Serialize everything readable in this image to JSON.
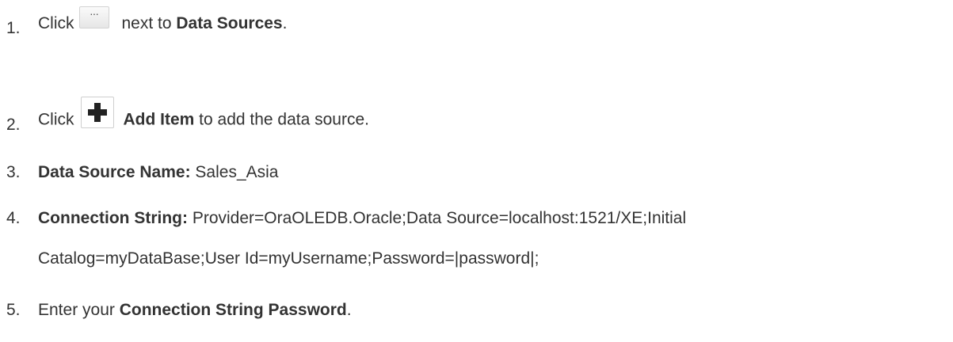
{
  "steps": [
    {
      "number": "1.",
      "text_before_icon": "Click",
      "icon": "ellipsis-icon",
      "text_after_icon": "next to ",
      "bold": "Data Sources",
      "text_end": "."
    },
    {
      "number": "2.",
      "text_before_icon": "Click",
      "icon": "plus-icon",
      "bold": "Add Item",
      "text_end": " to add the data source."
    },
    {
      "number": "3.",
      "bold": "Data Source Name:",
      "text_end": " Sales_Asia"
    },
    {
      "number": "4.",
      "bold": "Connection String:",
      "text_end": " Provider=OraOLEDB.Oracle;Data Source=localhost:1521/XE;Initial",
      "continuation": "Catalog=myDataBase;User Id=myUsername;Password=|password|;"
    },
    {
      "number": "5.",
      "text_before": "Enter your ",
      "bold": "Connection String Password",
      "text_end": "."
    }
  ],
  "icons": {
    "ellipsis_glyph": "···"
  }
}
